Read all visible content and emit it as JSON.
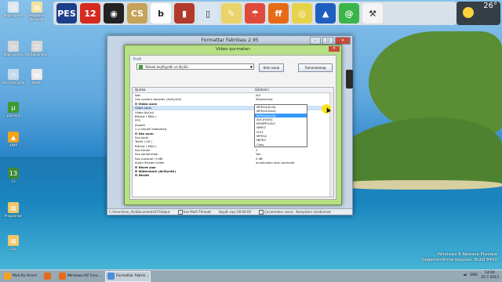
{
  "desktop": {
    "icons": [
      {
        "label": "Bilgisayarım",
        "color": "#dfe7ef",
        "glyph": "▭",
        "icon": "computer-icon"
      },
      {
        "label": "Belgelerim Kısayolu",
        "color": "#f3e3a0",
        "glyph": "▤",
        "icon": "folder-icon"
      },
      {
        "label": "Bilgisayarım",
        "color": "#d6d6d6",
        "glyph": "▭",
        "icon": "computer-icon"
      },
      {
        "label": "Ağ Bağlantıları",
        "color": "#d6d6d6",
        "glyph": "◫",
        "icon": "network-icon"
      },
      {
        "label": "Geri Dönüşüm",
        "color": "#c7d9ec",
        "glyph": "♲",
        "icon": "recycle-bin-icon"
      },
      {
        "label": "Notlar",
        "color": "#e9e9e9",
        "glyph": "▤",
        "icon": "document-icon"
      },
      {
        "label": "µTorrent",
        "color": "#3f9a32",
        "glyph": "µ",
        "icon": "utorrent-icon"
      },
      {
        "label": "AIMP",
        "color": "#f6a21a",
        "glyph": "▲",
        "icon": "aimp-icon"
      },
      {
        "label": "13",
        "color": "#3c8a3a",
        "glyph": "13",
        "icon": "game-icon"
      },
      {
        "label": "Programlar",
        "color": "#f2c66a",
        "glyph": "▤",
        "icon": "folder-icon"
      },
      {
        "label": "Çöp",
        "color": "#f2c66a",
        "glyph": "▤",
        "icon": "folder-icon"
      }
    ]
  },
  "dock": {
    "items": [
      {
        "label": "PES",
        "color": "#1b3f8a",
        "icon": "pes-icon"
      },
      {
        "label": "12",
        "color": "#d62a20",
        "icon": "channel-12-icon"
      },
      {
        "label": "◉",
        "color": "#222",
        "icon": "camera-icon"
      },
      {
        "label": "CS",
        "color": "#c6a35a",
        "icon": "counter-strike-icon"
      },
      {
        "label": "b",
        "color": "#ffffff",
        "icon": "b-app-icon"
      },
      {
        "label": "▮",
        "color": "#b23a2b",
        "icon": "game-figure-icon"
      },
      {
        "label": "▯",
        "color": "#d8e6f2",
        "icon": "trash-icon"
      },
      {
        "label": "✎",
        "color": "#e9d36a",
        "icon": "clean-tool-icon"
      },
      {
        "label": "☂",
        "color": "#e04a3a",
        "icon": "umbrella-icon"
      },
      {
        "label": "ff",
        "color": "#e66b16",
        "icon": "firefox-icon"
      },
      {
        "label": "◎",
        "color": "#e6d34a",
        "icon": "chrome-icon"
      },
      {
        "label": "▲",
        "color": "#1f5fbf",
        "icon": "navigator-icon"
      },
      {
        "label": "@",
        "color": "#3bb44a",
        "icon": "mail-icon"
      },
      {
        "label": "⚒",
        "color": "#f4f4f4",
        "icon": "tools-icon"
      }
    ]
  },
  "weather": {
    "temp": "26°"
  },
  "main_window": {
    "title": "Formattar Fabrikası 2.95",
    "status": {
      "output_path": "C:\\Users\\han_d\\s\\Documents\\FFOutput",
      "multithread": "Use Multi-Threads",
      "elapsed": "Kayıtlı sayı 00:00:00",
      "after_convert": "Çevirmeden sonra : Kompüteri söndürmək"
    }
  },
  "dialog": {
    "title": "Video qurmaları",
    "profile_label": "Profil",
    "profile_value": "Yüksek keyfiyyətli və ölçülü",
    "save_as": "Kimi saxla",
    "ok": "Tamamlamaq",
    "columns": [
      "Qurma",
      "Göstərici"
    ],
    "rows": [
      {
        "name": "Növ",
        "value": "AVI",
        "kind": ""
      },
      {
        "name": "Use system decoder (AviSynth)",
        "value": "Söndürmək",
        "kind": ""
      },
      {
        "name": "Video axını",
        "value": "",
        "kind": "grp"
      },
      {
        "name": "Video kodu",
        "value": "MPEG4(Xvid)",
        "kind": "sel"
      },
      {
        "name": "Video ölçüsü",
        "value": "MPEG4(DivX)",
        "kind": ""
      },
      {
        "name": "Bitreyt ( KB/s )",
        "value": "",
        "kind": ""
      },
      {
        "name": "FPS",
        "value": "",
        "kind": ""
      },
      {
        "name": "Aspekt",
        "value": "",
        "kind": ""
      },
      {
        "name": "2-ci keçidli kodlamaq",
        "value": "",
        "kind": ""
      },
      {
        "name": "Səs axını",
        "value": "",
        "kind": "grp"
      },
      {
        "name": "Səs kodu",
        "value": "",
        "kind": ""
      },
      {
        "name": "Tezlik ( HZ )",
        "value": "44100",
        "kind": ""
      },
      {
        "name": "Bitreyt ( KB/s )",
        "value": "128",
        "kind": ""
      },
      {
        "name": "Səs kanalı",
        "value": "2",
        "kind": ""
      },
      {
        "name": "Səs söndürmək",
        "value": "Yox",
        "kind": ""
      },
      {
        "name": "Səs nəzarəti (+dB)",
        "value": "0 dB",
        "kind": ""
      },
      {
        "name": "Audio Stream Index",
        "value": "əvvəlcədən olan qurmalar",
        "kind": ""
      },
      {
        "name": "Əlavə yazı",
        "value": "",
        "kind": "grpc"
      },
      {
        "name": "Watermark (AviSynth)",
        "value": "",
        "kind": "grpc"
      },
      {
        "name": "Ətraflı",
        "value": "",
        "kind": "grpc"
      }
    ],
    "dropdown": [
      "MPEG4(Xvid)",
      "MPEG4(DivX)",
      "MPEG4(Xvid)",
      "AVC(H264)",
      "MSMPEG4V2",
      "WMV2",
      "FLV1",
      "MPEG2",
      "MJPEG",
      "Copy"
    ],
    "dropdown_selected": 2
  },
  "watermark": {
    "line1": "Windows 8 Release Preview",
    "line2": "Değerlendirme kopyası. Build 8400"
  },
  "taskbar": {
    "items": [
      {
        "label": "Mail.Ru Агент",
        "color": "#f7a21b",
        "icon": "mailru-agent-icon",
        "active": false
      },
      {
        "label": "",
        "color": "#e66b16",
        "icon": "firefox-icon",
        "active": false
      },
      {
        "label": "Windows-AZ Foru...",
        "color": "#e66b16",
        "icon": "firefox-icon",
        "active": false
      },
      {
        "label": "Formattar Fabrik...",
        "color": "#4a90d9",
        "icon": "format-factory-icon",
        "active": true
      }
    ],
    "lang": "ENG",
    "time": "14:04",
    "date": "20.7.2012"
  }
}
